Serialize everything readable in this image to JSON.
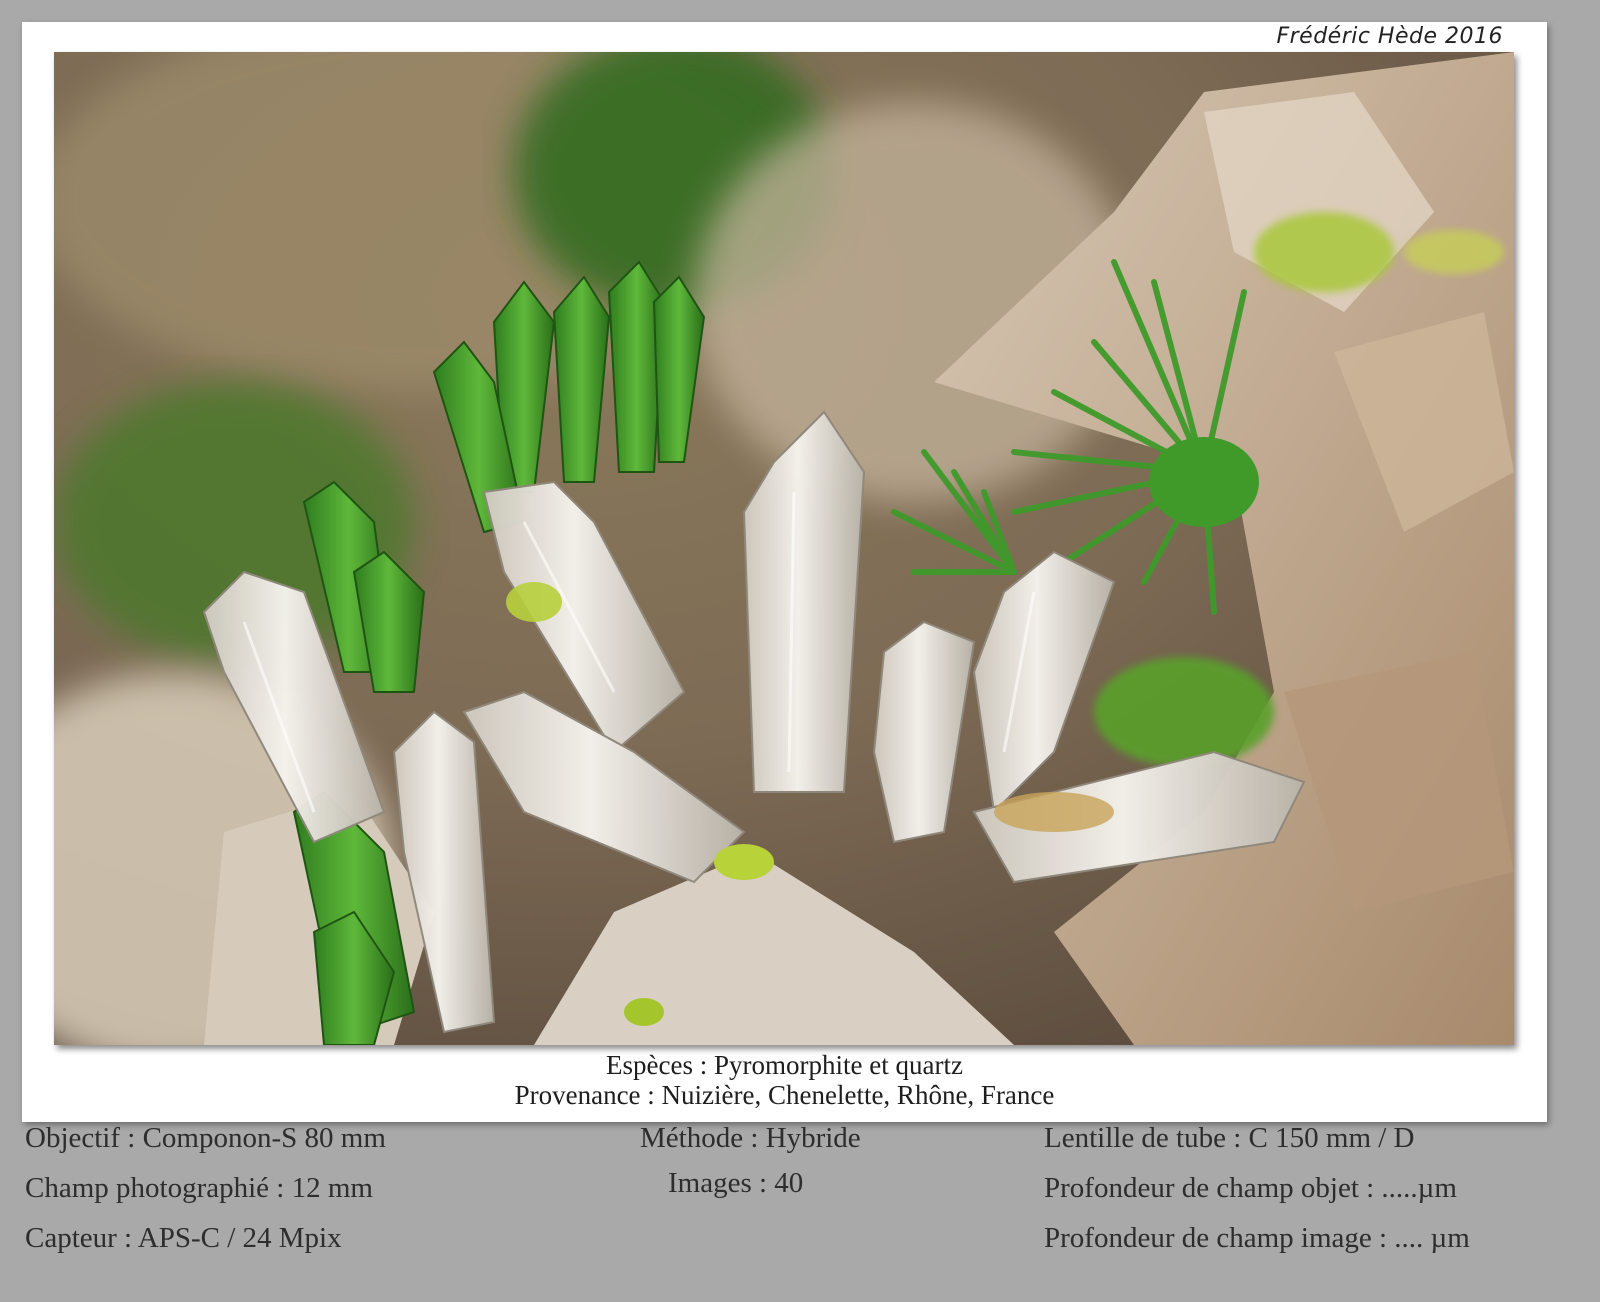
{
  "signature": "Frédéric Hède 2016",
  "caption": {
    "species": "Espèces : Pyromorphite et quartz",
    "provenance": "Provenance : Nuizière, Chenelette, Rhône, France"
  },
  "info": {
    "left": [
      "Objectif : Componon-S 80 mm",
      "Champ photographié : 12 mm",
      "Capteur : APS-C / 24 Mpix"
    ],
    "middle": [
      "Méthode : Hybride",
      "Images : 40"
    ],
    "right": [
      "Lentille de tube : C 150 mm / D",
      "Profondeur de champ objet : .....µm",
      "Profondeur de champ image : .... µm"
    ]
  },
  "colors": {
    "page_background": "#a9a9a9",
    "frame": "#ffffff",
    "pyromorphite_green": "#3f9a2a",
    "quartz": "#e8e2d8",
    "matrix_brown": "#b08a62"
  }
}
